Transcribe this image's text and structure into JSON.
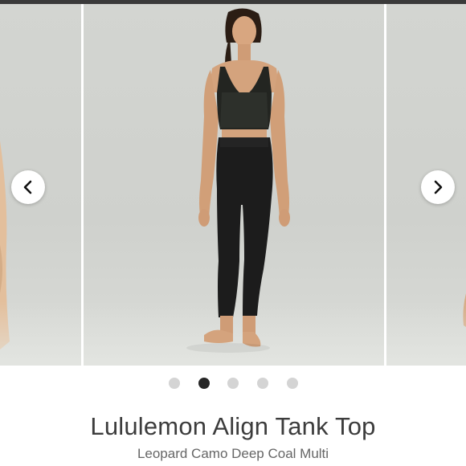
{
  "carousel": {
    "slide_count": 5,
    "active_index": 1,
    "prev_icon": "chevron-left-icon",
    "next_icon": "chevron-right-icon"
  },
  "product": {
    "title": "Lululemon Align Tank Top",
    "color_name": "Leopard Camo Deep Coal Multi"
  },
  "colors": {
    "background": "#ffffff",
    "photo_backdrop": "#d3d5d1",
    "dot_active": "#262626",
    "dot_inactive": "#d4d4d4",
    "garment": "#1c1c1c"
  }
}
